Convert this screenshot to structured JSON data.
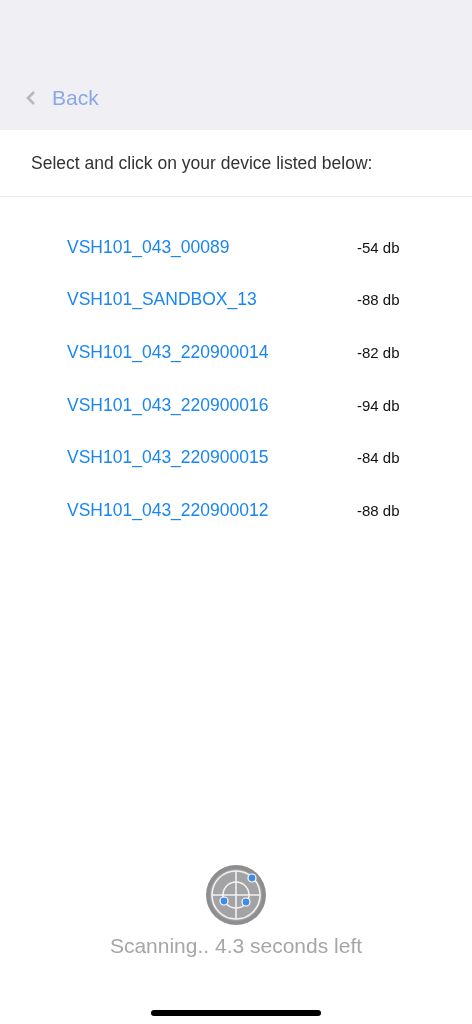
{
  "nav": {
    "back": "Back"
  },
  "instruction": "Select and click on your device listed below:",
  "devices": [
    {
      "name": "VSH101_043_00089",
      "signal": "-54 db"
    },
    {
      "name": "VSH101_SANDBOX_13",
      "signal": "-88 db"
    },
    {
      "name": "VSH101_043_220900014",
      "signal": "-82 db"
    },
    {
      "name": "VSH101_043_220900016",
      "signal": "-94 db"
    },
    {
      "name": "VSH101_043_220900015",
      "signal": "-84 db"
    },
    {
      "name": "VSH101_043_220900012",
      "signal": "-88 db"
    }
  ],
  "status": "Scanning.. 4.3 seconds left"
}
